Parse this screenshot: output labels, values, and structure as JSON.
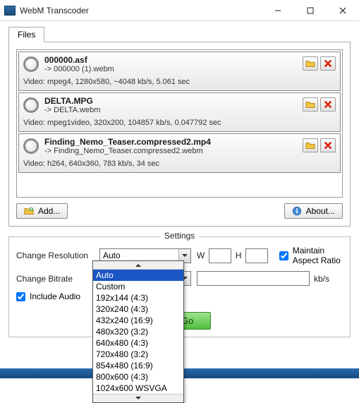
{
  "window": {
    "title": "WebM Transcoder"
  },
  "tabs": {
    "files": "Files"
  },
  "files": [
    {
      "name": "000000.asf",
      "output": "-> 000000 (1).webm",
      "info": "Video: mpeg4, 1280x580, ~4048 kb/s, 5.061 sec"
    },
    {
      "name": "DELTA.MPG",
      "output": "-> DELTA.webm",
      "info": "Video: mpeg1video, 320x200, 104857 kb/s, 0.047792 sec"
    },
    {
      "name": "Finding_Nemo_Teaser.compressed2.mp4",
      "output": "-> Finding_Nemo_Teaser.compressed2.webm",
      "info": "Video: h264, 640x360, 783 kb/s, 34 sec"
    }
  ],
  "toolbar": {
    "add": "Add...",
    "about": "About..."
  },
  "settings": {
    "legend": "Settings",
    "change_resolution_label": "Change Resolution",
    "change_bitrate_label": "Change Bitrate",
    "include_audio_label": "Include Audio",
    "w_label": "W",
    "h_label": "H",
    "maintain_ar_label": "Maintain Aspect Ratio",
    "kbs_label": "kb/s",
    "resolution_value": "Auto",
    "bitrate_value": "",
    "w_value": "",
    "h_value": "",
    "include_audio_checked": true,
    "maintain_ar_checked": true,
    "resolution_options": [
      "Auto",
      "Custom",
      "192x144 (4:3)",
      "320x240 (4:3)",
      "432x240 (16:9)",
      "480x320 (3:2)",
      "640x480 (4:3)",
      "720x480 (3:2)",
      "854x480 (16:9)",
      "800x600 (4:3)",
      "1024x600 WSVGA"
    ],
    "resolution_selected_index": 0
  },
  "go": {
    "label": "Go"
  }
}
